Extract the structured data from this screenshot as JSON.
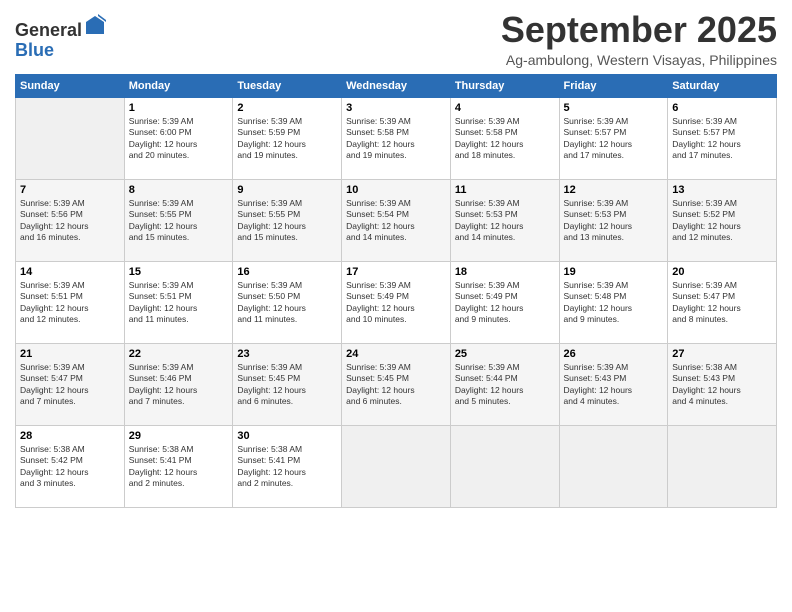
{
  "header": {
    "logo_line1": "General",
    "logo_line2": "Blue",
    "title": "September 2025",
    "subtitle": "Ag-ambulong, Western Visayas, Philippines"
  },
  "days_of_week": [
    "Sunday",
    "Monday",
    "Tuesday",
    "Wednesday",
    "Thursday",
    "Friday",
    "Saturday"
  ],
  "weeks": [
    [
      {
        "day": "",
        "info": ""
      },
      {
        "day": "1",
        "info": "Sunrise: 5:39 AM\nSunset: 6:00 PM\nDaylight: 12 hours\nand 20 minutes."
      },
      {
        "day": "2",
        "info": "Sunrise: 5:39 AM\nSunset: 5:59 PM\nDaylight: 12 hours\nand 19 minutes."
      },
      {
        "day": "3",
        "info": "Sunrise: 5:39 AM\nSunset: 5:58 PM\nDaylight: 12 hours\nand 19 minutes."
      },
      {
        "day": "4",
        "info": "Sunrise: 5:39 AM\nSunset: 5:58 PM\nDaylight: 12 hours\nand 18 minutes."
      },
      {
        "day": "5",
        "info": "Sunrise: 5:39 AM\nSunset: 5:57 PM\nDaylight: 12 hours\nand 17 minutes."
      },
      {
        "day": "6",
        "info": "Sunrise: 5:39 AM\nSunset: 5:57 PM\nDaylight: 12 hours\nand 17 minutes."
      }
    ],
    [
      {
        "day": "7",
        "info": "Sunrise: 5:39 AM\nSunset: 5:56 PM\nDaylight: 12 hours\nand 16 minutes."
      },
      {
        "day": "8",
        "info": "Sunrise: 5:39 AM\nSunset: 5:55 PM\nDaylight: 12 hours\nand 15 minutes."
      },
      {
        "day": "9",
        "info": "Sunrise: 5:39 AM\nSunset: 5:55 PM\nDaylight: 12 hours\nand 15 minutes."
      },
      {
        "day": "10",
        "info": "Sunrise: 5:39 AM\nSunset: 5:54 PM\nDaylight: 12 hours\nand 14 minutes."
      },
      {
        "day": "11",
        "info": "Sunrise: 5:39 AM\nSunset: 5:53 PM\nDaylight: 12 hours\nand 14 minutes."
      },
      {
        "day": "12",
        "info": "Sunrise: 5:39 AM\nSunset: 5:53 PM\nDaylight: 12 hours\nand 13 minutes."
      },
      {
        "day": "13",
        "info": "Sunrise: 5:39 AM\nSunset: 5:52 PM\nDaylight: 12 hours\nand 12 minutes."
      }
    ],
    [
      {
        "day": "14",
        "info": "Sunrise: 5:39 AM\nSunset: 5:51 PM\nDaylight: 12 hours\nand 12 minutes."
      },
      {
        "day": "15",
        "info": "Sunrise: 5:39 AM\nSunset: 5:51 PM\nDaylight: 12 hours\nand 11 minutes."
      },
      {
        "day": "16",
        "info": "Sunrise: 5:39 AM\nSunset: 5:50 PM\nDaylight: 12 hours\nand 11 minutes."
      },
      {
        "day": "17",
        "info": "Sunrise: 5:39 AM\nSunset: 5:49 PM\nDaylight: 12 hours\nand 10 minutes."
      },
      {
        "day": "18",
        "info": "Sunrise: 5:39 AM\nSunset: 5:49 PM\nDaylight: 12 hours\nand 9 minutes."
      },
      {
        "day": "19",
        "info": "Sunrise: 5:39 AM\nSunset: 5:48 PM\nDaylight: 12 hours\nand 9 minutes."
      },
      {
        "day": "20",
        "info": "Sunrise: 5:39 AM\nSunset: 5:47 PM\nDaylight: 12 hours\nand 8 minutes."
      }
    ],
    [
      {
        "day": "21",
        "info": "Sunrise: 5:39 AM\nSunset: 5:47 PM\nDaylight: 12 hours\nand 7 minutes."
      },
      {
        "day": "22",
        "info": "Sunrise: 5:39 AM\nSunset: 5:46 PM\nDaylight: 12 hours\nand 7 minutes."
      },
      {
        "day": "23",
        "info": "Sunrise: 5:39 AM\nSunset: 5:45 PM\nDaylight: 12 hours\nand 6 minutes."
      },
      {
        "day": "24",
        "info": "Sunrise: 5:39 AM\nSunset: 5:45 PM\nDaylight: 12 hours\nand 6 minutes."
      },
      {
        "day": "25",
        "info": "Sunrise: 5:39 AM\nSunset: 5:44 PM\nDaylight: 12 hours\nand 5 minutes."
      },
      {
        "day": "26",
        "info": "Sunrise: 5:39 AM\nSunset: 5:43 PM\nDaylight: 12 hours\nand 4 minutes."
      },
      {
        "day": "27",
        "info": "Sunrise: 5:38 AM\nSunset: 5:43 PM\nDaylight: 12 hours\nand 4 minutes."
      }
    ],
    [
      {
        "day": "28",
        "info": "Sunrise: 5:38 AM\nSunset: 5:42 PM\nDaylight: 12 hours\nand 3 minutes."
      },
      {
        "day": "29",
        "info": "Sunrise: 5:38 AM\nSunset: 5:41 PM\nDaylight: 12 hours\nand 2 minutes."
      },
      {
        "day": "30",
        "info": "Sunrise: 5:38 AM\nSunset: 5:41 PM\nDaylight: 12 hours\nand 2 minutes."
      },
      {
        "day": "",
        "info": ""
      },
      {
        "day": "",
        "info": ""
      },
      {
        "day": "",
        "info": ""
      },
      {
        "day": "",
        "info": ""
      }
    ]
  ]
}
